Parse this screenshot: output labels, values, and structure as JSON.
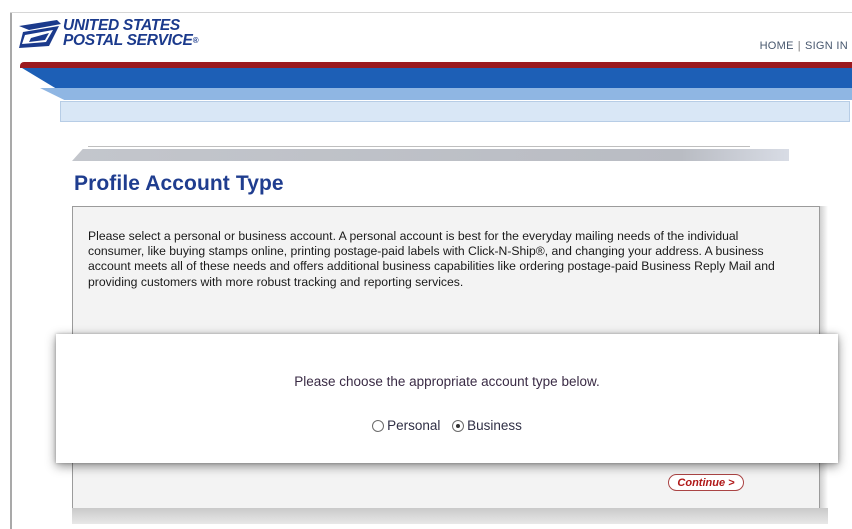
{
  "header": {
    "logo_line1": "UNITED STATES",
    "logo_line2": "POSTAL SERVICE",
    "logo_reg": "®",
    "nav": {
      "home": "HOME",
      "separator": "|",
      "sign_in": "SIGN IN"
    }
  },
  "page": {
    "title": "Profile Account Type",
    "description": "Please select a personal or business account. A personal account is best for the everyday mailing needs of the individual consumer, like buying stamps online, printing postage-paid labels with Click-N-Ship®, and changing your address. A business account meets all of these needs and offers additional business capabilities like ordering postage-paid Business Reply Mail and providing customers with more robust tracking and reporting services."
  },
  "modal": {
    "message": "Please choose the appropriate account type below.",
    "options": [
      {
        "label": "Personal",
        "checked": false
      },
      {
        "label": "Business",
        "checked": true
      }
    ]
  },
  "continue_label": "Continue >",
  "colors": {
    "brand_blue": "#1d5fb6",
    "brand_red": "#9b1a1f",
    "title_blue": "#1f3d8f"
  }
}
